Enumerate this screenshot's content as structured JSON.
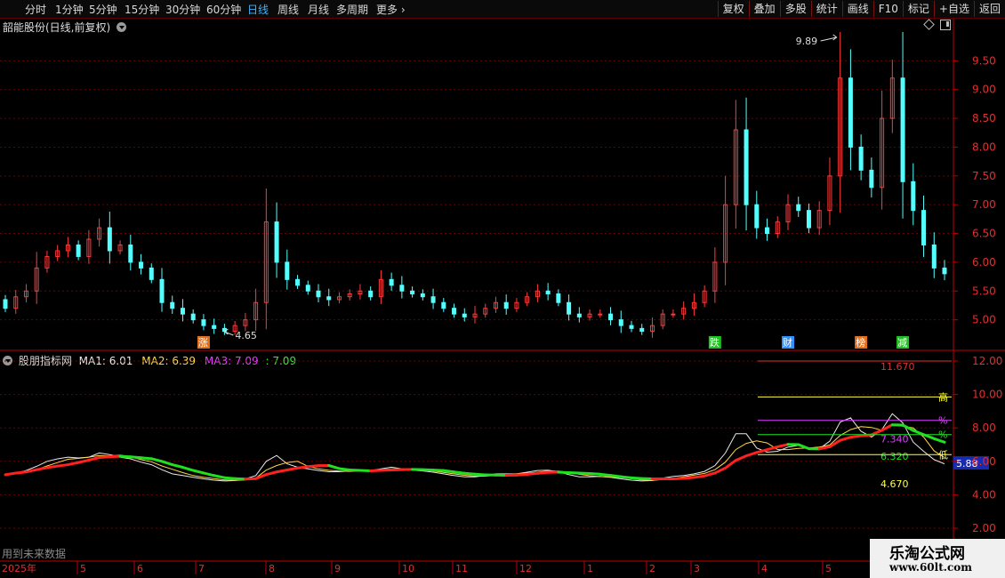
{
  "toolbar": {
    "periods": [
      "分时",
      "1分钟",
      "5分钟",
      "15分钟",
      "30分钟",
      "60分钟",
      "日线",
      "周线",
      "月线",
      "多周期",
      "更多"
    ],
    "active": "日线",
    "buttons": [
      "复权",
      "叠加",
      "多股",
      "统计",
      "画线",
      "F10",
      "标记",
      "+自选",
      "返回"
    ]
  },
  "main_title": "韶能股份(日线,前复权)",
  "indicator": {
    "name": "股朋指标网",
    "ma1": "MA1: 6.01",
    "ma2": "MA2: 6.39",
    "ma3": "MA3: 7.09",
    "ma4": ": 7.09"
  },
  "future_note": "用到未来数据",
  "logo": {
    "line1": "乐淘公式网",
    "line2": "www.60lt.com"
  },
  "colors": {
    "up": "#ff3a3a",
    "down": "#54ffff",
    "ma_red": "#ff2020",
    "ma_green": "#20e020",
    "axis": "#c00000"
  },
  "chart_data": [
    {
      "type": "candlestick",
      "y_axis_ticks": [
        "9.50",
        "9.00",
        "8.50",
        "8.00",
        "7.50",
        "7.00",
        "6.50",
        "6.00",
        "5.50",
        "5.00"
      ],
      "ylim": [
        4.5,
        10.0
      ],
      "annotations": {
        "high": "9.89",
        "low": "4.65"
      },
      "signals": [
        {
          "text": "涨",
          "color": "#e07020",
          "index": 19
        },
        {
          "text": "跌",
          "color": "#20c020",
          "index": 68
        },
        {
          "text": "财",
          "color": "#3090ff",
          "index": 75
        },
        {
          "text": "榜",
          "color": "#e07020",
          "index": 82
        },
        {
          "text": "减",
          "color": "#20c020",
          "index": 86
        }
      ],
      "closes": [
        5.2,
        5.4,
        5.5,
        5.9,
        6.1,
        6.2,
        6.3,
        6.1,
        6.4,
        6.6,
        6.2,
        6.3,
        6.0,
        5.9,
        5.7,
        5.3,
        5.2,
        5.1,
        5.0,
        4.9,
        4.85,
        4.8,
        4.9,
        5.0,
        5.3,
        6.7,
        6.0,
        5.7,
        5.6,
        5.5,
        5.4,
        5.35,
        5.4,
        5.45,
        5.5,
        5.4,
        5.7,
        5.6,
        5.5,
        5.45,
        5.4,
        5.3,
        5.2,
        5.1,
        5.05,
        5.1,
        5.2,
        5.3,
        5.2,
        5.3,
        5.4,
        5.5,
        5.45,
        5.3,
        5.1,
        5.05,
        5.1,
        5.1,
        5.0,
        4.9,
        4.85,
        4.8,
        4.9,
        5.1,
        5.1,
        5.2,
        5.3,
        5.5,
        6.0,
        7.0,
        8.3,
        7.0,
        6.6,
        6.5,
        6.7,
        7.0,
        6.9,
        6.6,
        6.9,
        7.5,
        9.2,
        8.0,
        7.6,
        7.3,
        8.5,
        9.2,
        7.4,
        6.9,
        6.3,
        5.9,
        5.8
      ]
    },
    {
      "type": "line",
      "y_axis_ticks": [
        "12.00",
        "10.00",
        "8.00",
        "6.00",
        "4.00",
        "2.00"
      ],
      "ylim": [
        2.0,
        12.0
      ],
      "series": [
        {
          "name": "MA1",
          "color": "#e8e8e8"
        },
        {
          "name": "MA2",
          "color": "#ffd84a"
        },
        {
          "name": "MA3",
          "color": "#ff2020",
          "alt_color": "#20e020"
        }
      ],
      "levels": [
        {
          "text": "11.670",
          "value": 11.67,
          "color": "#e03030"
        },
        {
          "text": "高",
          "value": 9.85,
          "color": "#ffff40"
        },
        {
          "text": "%",
          "value": 8.45,
          "color": "#e040ff"
        },
        {
          "text": "%",
          "value": 7.6,
          "color": "#20e020"
        },
        {
          "text": "7.340",
          "value": 7.34,
          "color": "#e040ff"
        },
        {
          "text": "6.320",
          "value": 6.32,
          "color": "#20e020"
        },
        {
          "text": "低",
          "value": 6.4,
          "color": "#ffff40"
        },
        {
          "text": "4.670",
          "value": 4.67,
          "color": "#ffff40"
        }
      ],
      "last_value": "5.88"
    }
  ],
  "x_axis": {
    "year": "2025年",
    "months": [
      "5",
      "6",
      "7",
      "8",
      "9",
      "10",
      "11",
      "12",
      "1",
      "2",
      "3",
      "4",
      "5"
    ]
  }
}
